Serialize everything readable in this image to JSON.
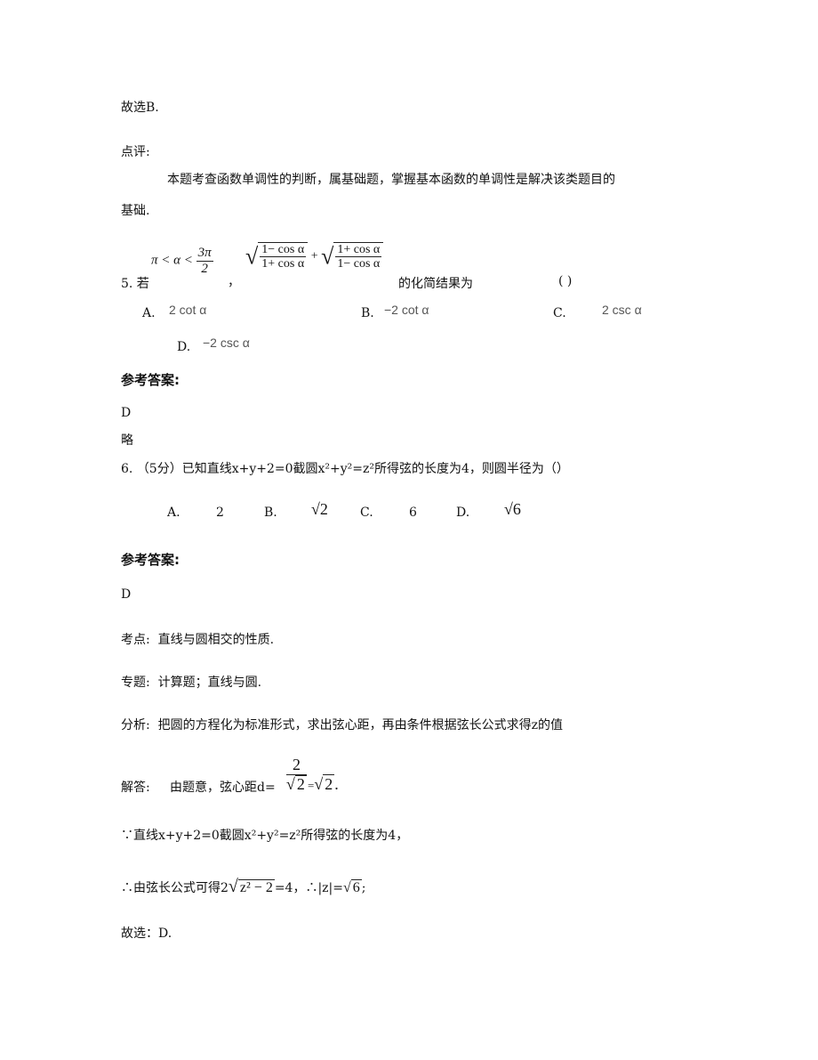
{
  "prev": {
    "answer_line": "故选B.",
    "comment_label": "点评:",
    "comment_text_line1": "本题考查函数单调性的判断，属基础题，掌握基本函数的单调性是解决该类题目的",
    "comment_text_line2": "基础."
  },
  "q5": {
    "number": "5. 若",
    "condition": {
      "lhs": "π < α <",
      "num": "3π",
      "den": "2"
    },
    "comma": "，",
    "expr": {
      "t1_num": "1− cos α",
      "t1_den": "1+ cos α",
      "plus": "+",
      "t2_num": "1+ cos α",
      "t2_den": "1− cos α"
    },
    "suffix": "的化简结果为",
    "blank": "(      )",
    "options": [
      {
        "label": "A.",
        "value": "2 cot α"
      },
      {
        "label": "B.",
        "value": "−2 cot α"
      },
      {
        "label": "C.",
        "value": "2 csc α"
      },
      {
        "label": "D.",
        "value": "−2 csc α"
      }
    ],
    "answer_heading": "参考答案:",
    "answer": "D",
    "note": "略"
  },
  "q6": {
    "stem_prefix": "6. （5分）已知直线x+y+2=0截圆",
    "stem_circle": "x²+y²=z²",
    "stem_suffix": "所得弦的长度为4，则圆半径为（）",
    "options": [
      {
        "label": "A.",
        "value": "2"
      },
      {
        "label": "B.",
        "value": "√2"
      },
      {
        "label": "C.",
        "value": "6"
      },
      {
        "label": "D.",
        "value": "√6"
      }
    ],
    "answer_heading": "参考答案:",
    "answer": "D",
    "kaodian_label": "考点:",
    "kaodian": "直线与圆相交的性质.",
    "zhuanti_label": "专题:",
    "zhuanti": "计算题；直线与圆.",
    "fenxi_label": "分析:",
    "fenxi": "把圆的方程化为标准形式，求出弦心距，再由条件根据弦长公式求得z的值",
    "jieda_label": "解答:",
    "jieda_prefix": "由题意，弦心距d=",
    "jieda_frac_num": "2",
    "jieda_frac_den": "2",
    "jieda_eq": "=",
    "jieda_result": "2",
    "jieda_end": ".",
    "because_line": "∵直线x+y+2=0截圆x²+y²=z²所得弦的长度为4，",
    "therefore_prefix": "∴由弦长公式可得2",
    "therefore_rad": "z² − 2",
    "therefore_mid": "=4，∴|z|=",
    "therefore_rad2": "6",
    "therefore_end": ";",
    "final": "故选：D."
  }
}
